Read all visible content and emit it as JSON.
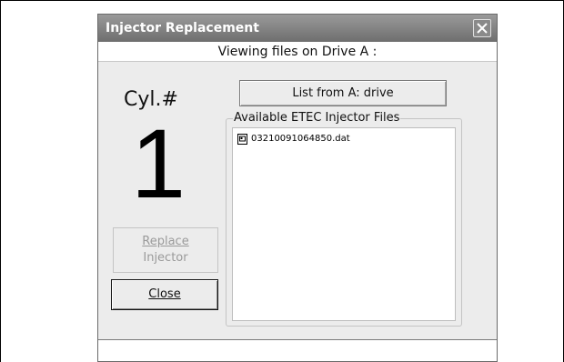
{
  "window": {
    "title": "Injector Replacement"
  },
  "subtitle": "Viewing files on Drive A :",
  "cylinder": {
    "label": "Cyl.#",
    "number": "1"
  },
  "buttons": {
    "list_from": "List from A: drive",
    "replace_line1": "Replace",
    "replace_line2": "Injector",
    "close": "Close"
  },
  "file_group": {
    "legend": "Available ETEC Injector Files",
    "files": [
      "03210091064850.dat"
    ]
  }
}
